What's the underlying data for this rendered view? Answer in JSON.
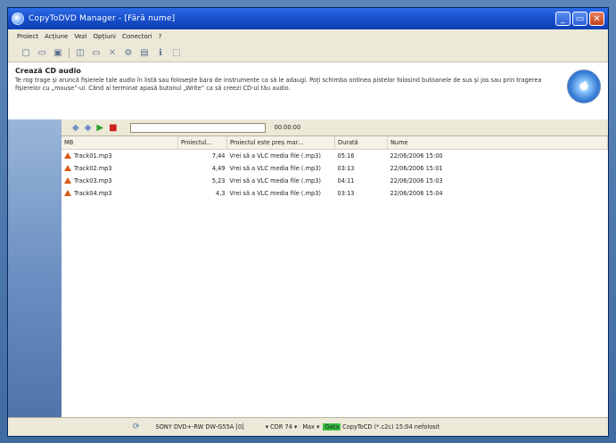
{
  "window": {
    "title": "CopyToDVD Manager - [Fără nume]"
  },
  "menu": [
    "Proiect",
    "Acțiune",
    "Vezi",
    "Opțiuni",
    "Conectori",
    "?"
  ],
  "header": {
    "title": "Crează CD audio",
    "description": "Te rog trage și aruncă fișierele tale audio în listă sau folosește bara de instrumente ca să le adaugi. Poți schimba ordinea pistelor folosind butoanele de sus și jos sau prin tragerea fișierelor cu „mouse”-ul. Când ai terminat apasă butonul „Write” ca să creezi CD-ul tău audio."
  },
  "player": {
    "time": "00:00:00",
    "progress": 0
  },
  "table": {
    "columns": [
      "MB",
      "Proiectul...",
      "Proiectul este preș mar...",
      "Durată",
      "Nume"
    ],
    "rows": [
      {
        "name": "Track01.mp3",
        "size": "7,44",
        "type": "Vrei să a VLC media file (.mp3)",
        "duration": "05:16",
        "date": "22/06/2006 15:00"
      },
      {
        "name": "Track02.mp3",
        "size": "4,49",
        "type": "Vrei să a VLC media file (.mp3)",
        "duration": "03:13",
        "date": "22/06/2006 15:01"
      },
      {
        "name": "Track03.mp3",
        "size": "5,23",
        "type": "Vrei să a VLC media file (.mp3)",
        "duration": "04:11",
        "date": "22/06/2006 15:03"
      },
      {
        "name": "Track04.mp3",
        "size": "4,3",
        "type": "Vrei să a VLC media file (.mp3)",
        "duration": "03:13",
        "date": "22/06/2006 15:04"
      }
    ]
  },
  "status": {
    "drive": "SONY   DVD+-RW DW-G55A  [0]",
    "media": "CDR 74",
    "speed": "Max",
    "state": "Gata",
    "app": "CopyToCD (*.c2c) 15:04 nefolosit"
  },
  "colors": {
    "titlebar": "#1a51cf",
    "status_highlight": "#3cbf3c",
    "warning_icon": "#d85a1a"
  }
}
